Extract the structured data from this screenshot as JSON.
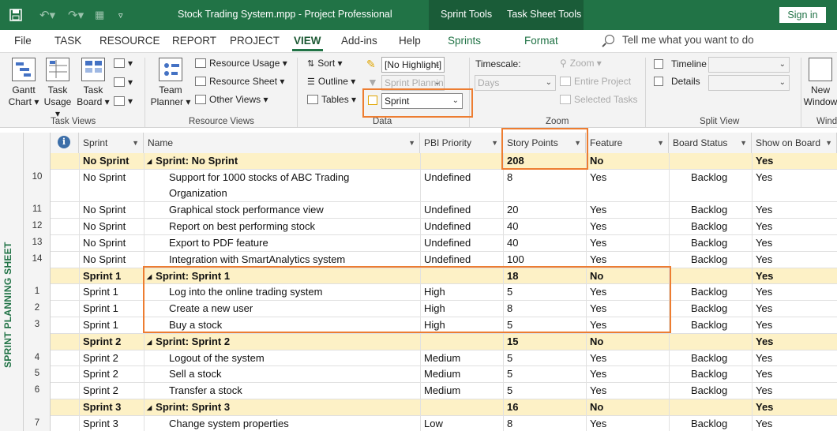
{
  "titlebar": {
    "title": "Stock Trading System.mpp  -  Project Professional",
    "context_tabs": [
      "Sprint Tools",
      "Task Sheet Tools"
    ],
    "sign_in": "Sign in",
    "color": "#217346"
  },
  "tabs": {
    "items": [
      "File",
      "TASK",
      "RESOURCE",
      "REPORT",
      "PROJECT",
      "VIEW",
      "Add-ins",
      "Help",
      "Sprints",
      "Format"
    ],
    "active": "VIEW",
    "tell_me": "Tell me what you want to do"
  },
  "ribbon": {
    "task_views": {
      "label": "Task Views",
      "gantt": [
        "Gantt",
        "Chart ▾"
      ],
      "task_usage": [
        "Task",
        "Usage ▾"
      ],
      "task_board": [
        "Task",
        "Board ▾"
      ]
    },
    "resource_views": {
      "label": "Resource Views",
      "team_planner": [
        "Team",
        "Planner ▾"
      ],
      "resource_usage": "Resource Usage ▾",
      "resource_sheet": "Resource Sheet ▾",
      "other_views": "Other Views ▾"
    },
    "data": {
      "label": "Data",
      "sort": "Sort ▾",
      "outline": "Outline ▾",
      "tables": "Tables ▾",
      "highlight": "[No Highlight]",
      "filter": "Sprint Planning",
      "group_by": "Sprint"
    },
    "zoom": {
      "label": "Zoom",
      "timescale_label": "Timescale:",
      "timescale": "Days",
      "zoom": "Zoom ▾",
      "entire_project": "Entire Project",
      "selected_tasks": "Selected Tasks"
    },
    "split_view": {
      "label": "Split View",
      "timeline": "Timeline",
      "details": "Details"
    },
    "window": {
      "label": "Windo",
      "new_window": [
        "New",
        "Window"
      ]
    }
  },
  "sheet": {
    "side_label": "SPRINT PLANNING SHEET",
    "columns": [
      "Sprint",
      "Name",
      "PBI Priority",
      "Story Points",
      "Feature",
      "Board Status",
      "Show on Board"
    ],
    "rows": [
      {
        "id": "",
        "group": true,
        "sprint": "No Sprint",
        "name": "Sprint: No Sprint",
        "priority": "",
        "points": "208",
        "feature": "No",
        "status": "",
        "show": "Yes"
      },
      {
        "id": "10",
        "group": false,
        "sprint": "No Sprint",
        "name": "Support for 1000 stocks of ABC Trading",
        "name2": "Organization",
        "priority": "Undefined",
        "points": "8",
        "feature": "Yes",
        "status": "Backlog",
        "show": "Yes"
      },
      {
        "id": "11",
        "group": false,
        "sprint": "No Sprint",
        "name": "Graphical stock performance view",
        "priority": "Undefined",
        "points": "20",
        "feature": "Yes",
        "status": "Backlog",
        "show": "Yes"
      },
      {
        "id": "12",
        "group": false,
        "sprint": "No Sprint",
        "name": "Report on best performing stock",
        "priority": "Undefined",
        "points": "40",
        "feature": "Yes",
        "status": "Backlog",
        "show": "Yes"
      },
      {
        "id": "13",
        "group": false,
        "sprint": "No Sprint",
        "name": "Export to PDF feature",
        "priority": "Undefined",
        "points": "40",
        "feature": "Yes",
        "status": "Backlog",
        "show": "Yes"
      },
      {
        "id": "14",
        "group": false,
        "sprint": "No Sprint",
        "name": "Integration with SmartAnalytics system",
        "priority": "Undefined",
        "points": "100",
        "feature": "Yes",
        "status": "Backlog",
        "show": "Yes"
      },
      {
        "id": "",
        "group": true,
        "sprint": "Sprint 1",
        "name": "Sprint: Sprint 1",
        "priority": "",
        "points": "18",
        "feature": "No",
        "status": "",
        "show": "Yes"
      },
      {
        "id": "1",
        "group": false,
        "sprint": "Sprint 1",
        "name": "Log into the online trading system",
        "priority": "High",
        "points": "5",
        "feature": "Yes",
        "status": "Backlog",
        "show": "Yes"
      },
      {
        "id": "2",
        "group": false,
        "sprint": "Sprint 1",
        "name": "Create a new user",
        "priority": "High",
        "points": "8",
        "feature": "Yes",
        "status": "Backlog",
        "show": "Yes"
      },
      {
        "id": "3",
        "group": false,
        "sprint": "Sprint 1",
        "name": "Buy a stock",
        "priority": "High",
        "points": "5",
        "feature": "Yes",
        "status": "Backlog",
        "show": "Yes"
      },
      {
        "id": "",
        "group": true,
        "sprint": "Sprint 2",
        "name": "Sprint: Sprint 2",
        "priority": "",
        "points": "15",
        "feature": "No",
        "status": "",
        "show": "Yes"
      },
      {
        "id": "4",
        "group": false,
        "sprint": "Sprint 2",
        "name": "Logout of the system",
        "priority": "Medium",
        "points": "5",
        "feature": "Yes",
        "status": "Backlog",
        "show": "Yes"
      },
      {
        "id": "5",
        "group": false,
        "sprint": "Sprint 2",
        "name": "Sell a stock",
        "priority": "Medium",
        "points": "5",
        "feature": "Yes",
        "status": "Backlog",
        "show": "Yes"
      },
      {
        "id": "6",
        "group": false,
        "sprint": "Sprint 2",
        "name": "Transfer a stock",
        "priority": "Medium",
        "points": "5",
        "feature": "Yes",
        "status": "Backlog",
        "show": "Yes"
      },
      {
        "id": "",
        "group": true,
        "sprint": "Sprint 3",
        "name": "Sprint: Sprint 3",
        "priority": "",
        "points": "16",
        "feature": "No",
        "status": "",
        "show": "Yes"
      },
      {
        "id": "7",
        "group": false,
        "sprint": "Sprint 3",
        "name": "Change system properties",
        "priority": "Low",
        "points": "8",
        "feature": "Yes",
        "status": "Backlog",
        "show": "Yes"
      }
    ]
  },
  "colors": {
    "accent": "#217346",
    "group_row": "#fdf1c6",
    "highlight_box": "#ed7d31"
  }
}
